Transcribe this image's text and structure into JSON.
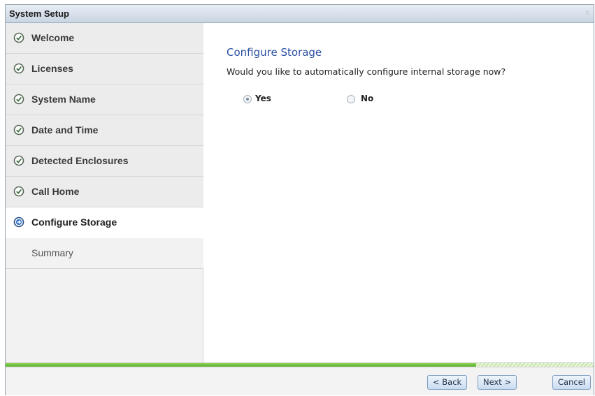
{
  "window": {
    "title": "System Setup",
    "close_glyph": "x"
  },
  "sidebar": {
    "steps": [
      {
        "label": "Welcome",
        "state": "completed",
        "icon": "check-circle-icon"
      },
      {
        "label": "Licenses",
        "state": "completed",
        "icon": "check-circle-icon"
      },
      {
        "label": "System Name",
        "state": "completed",
        "icon": "check-circle-icon"
      },
      {
        "label": "Date and Time",
        "state": "completed",
        "icon": "check-circle-icon"
      },
      {
        "label": "Detected Enclosures",
        "state": "completed",
        "icon": "check-circle-icon"
      },
      {
        "label": "Call Home",
        "state": "completed",
        "icon": "check-circle-icon"
      },
      {
        "label": "Configure Storage",
        "state": "current",
        "icon": "arrow-circle-icon"
      },
      {
        "label": "Summary",
        "state": "pending",
        "icon": ""
      }
    ]
  },
  "content": {
    "heading": "Configure Storage",
    "question": "Would you like to automatically configure internal storage now?",
    "options": [
      {
        "label": "Yes",
        "selected": true
      },
      {
        "label": "No",
        "selected": false
      }
    ]
  },
  "progress": {
    "fraction": 0.8
  },
  "footer": {
    "back_label": "< Back",
    "next_label": "Next >",
    "cancel_label": "Cancel"
  },
  "colors": {
    "heading": "#2a4fa0",
    "progress_fill": "#4ea92b",
    "check_icon": "#4a7a4a",
    "arrow_icon": "#2b63b8"
  }
}
